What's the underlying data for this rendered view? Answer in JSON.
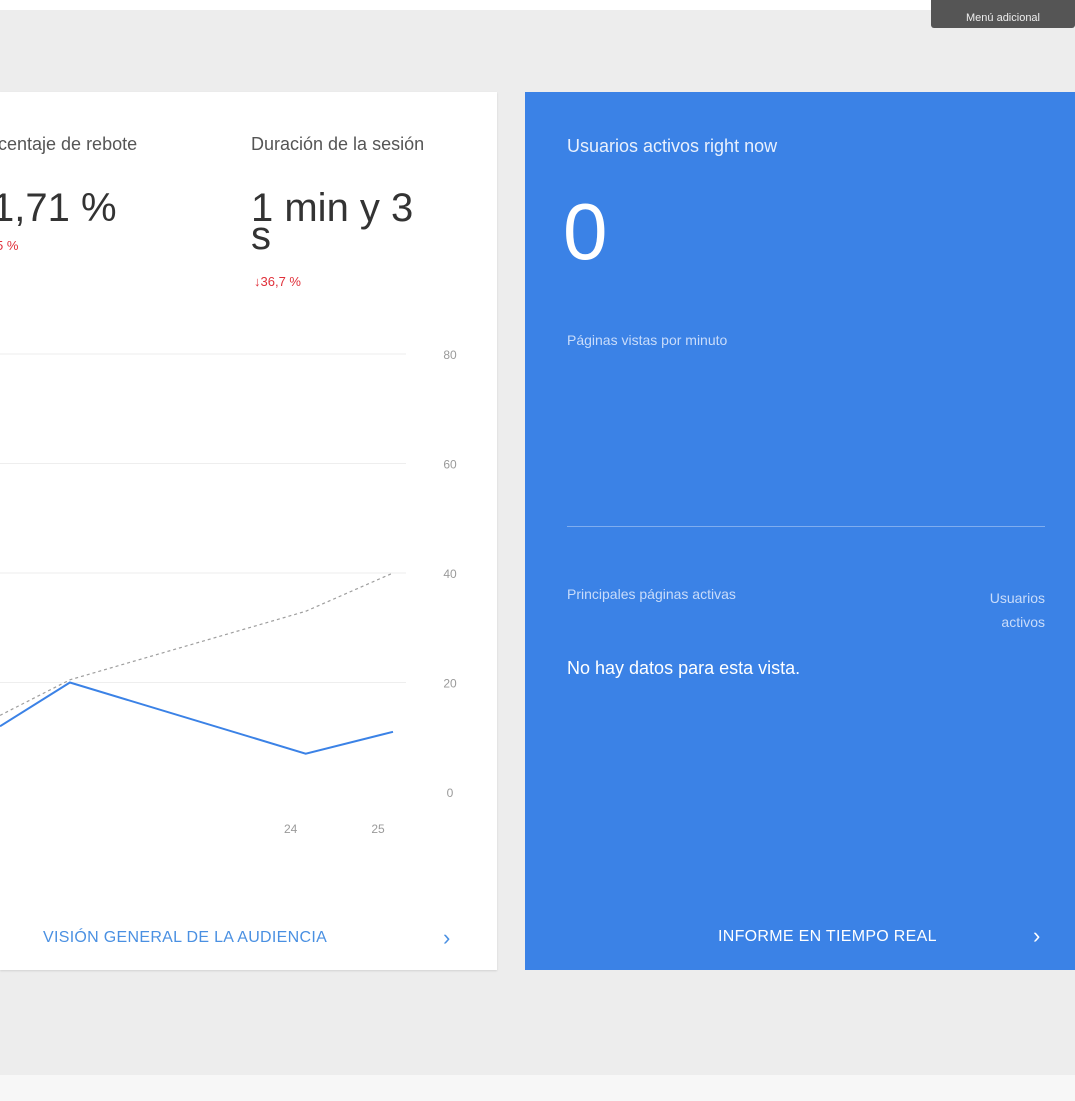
{
  "tooltip": {
    "text": "Menú adicional"
  },
  "audience_card": {
    "metrics": [
      {
        "label": "centaje de rebote",
        "value": "1,71 %",
        "delta": "5 %",
        "delta_direction": "down"
      },
      {
        "label": "Duración de la sesión",
        "value_line1": "1 min y 3",
        "value_line2": "s",
        "delta": "36,7 %",
        "delta_direction": "down"
      }
    ],
    "footer_link": "VISIÓN GENERAL DE LA AUDIENCIA",
    "footer_icon": "chevron-right-icon",
    "accent_color": "#4a90e2",
    "delta_color": "#e0303a"
  },
  "chart_data": {
    "type": "line",
    "x_tick_labels": [
      "24",
      "25"
    ],
    "y_tick_labels": [
      "80",
      "60",
      "40",
      "20",
      "0"
    ],
    "ylim": [
      0,
      80
    ],
    "grid": true,
    "series": [
      {
        "style": "solid",
        "color": "#3b82e6",
        "points": [
          [
            20.5,
            12
          ],
          [
            21.3,
            20
          ],
          [
            24,
            7
          ],
          [
            25,
            11
          ]
        ]
      },
      {
        "style": "dashed",
        "color": "#9e9e9e",
        "points": [
          [
            20.5,
            14
          ],
          [
            21.3,
            20.5
          ],
          [
            24,
            33
          ],
          [
            25,
            40
          ]
        ]
      }
    ]
  },
  "realtime_card": {
    "title": "Usuarios activos right now",
    "count": "0",
    "pageviews_label": "Páginas vistas por minuto",
    "top_pages_label": "Principales páginas activas",
    "active_users_label": "Usuarios activos",
    "empty_message": "No hay datos para esta vista.",
    "footer_link": "INFORME EN TIEMPO REAL",
    "footer_icon": "chevron-right-icon",
    "background_color": "#3b82e6"
  }
}
